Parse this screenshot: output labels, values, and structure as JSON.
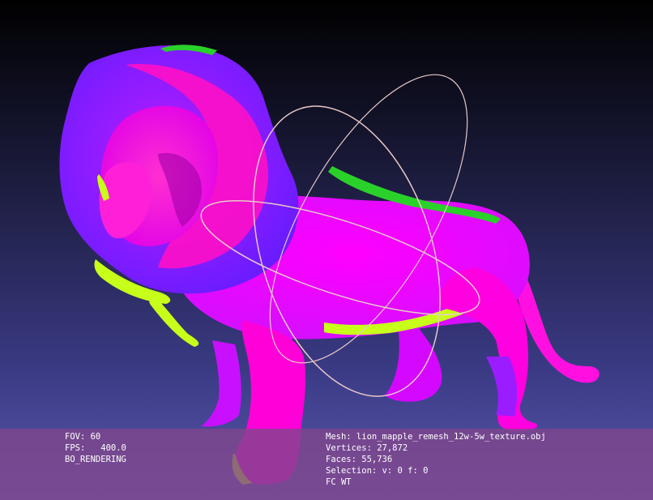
{
  "viewer": {
    "background_top": "#000000",
    "background_bottom": "#5a5ab0",
    "mesh_colors": {
      "magenta": "#ff00ff",
      "hot_pink": "#ff1fae",
      "violet": "#9b1cff",
      "blue_purple": "#6a1cff",
      "green": "#2ad12a",
      "yellow_green": "#c8ff1a"
    },
    "trackball_color": "#e8c8c8"
  },
  "hud": {
    "fov": "FOV: 60",
    "fps": "FPS:   400.0",
    "render_mode": "BO_RENDERING",
    "mesh": "Mesh: lion_mapple_remesh_12w-5w_texture.obj",
    "vertices": "Vertices: 27,872",
    "faces": "Faces: 55,736",
    "selection": "Selection: v: 0 f: 0",
    "mode": "FC WT"
  }
}
